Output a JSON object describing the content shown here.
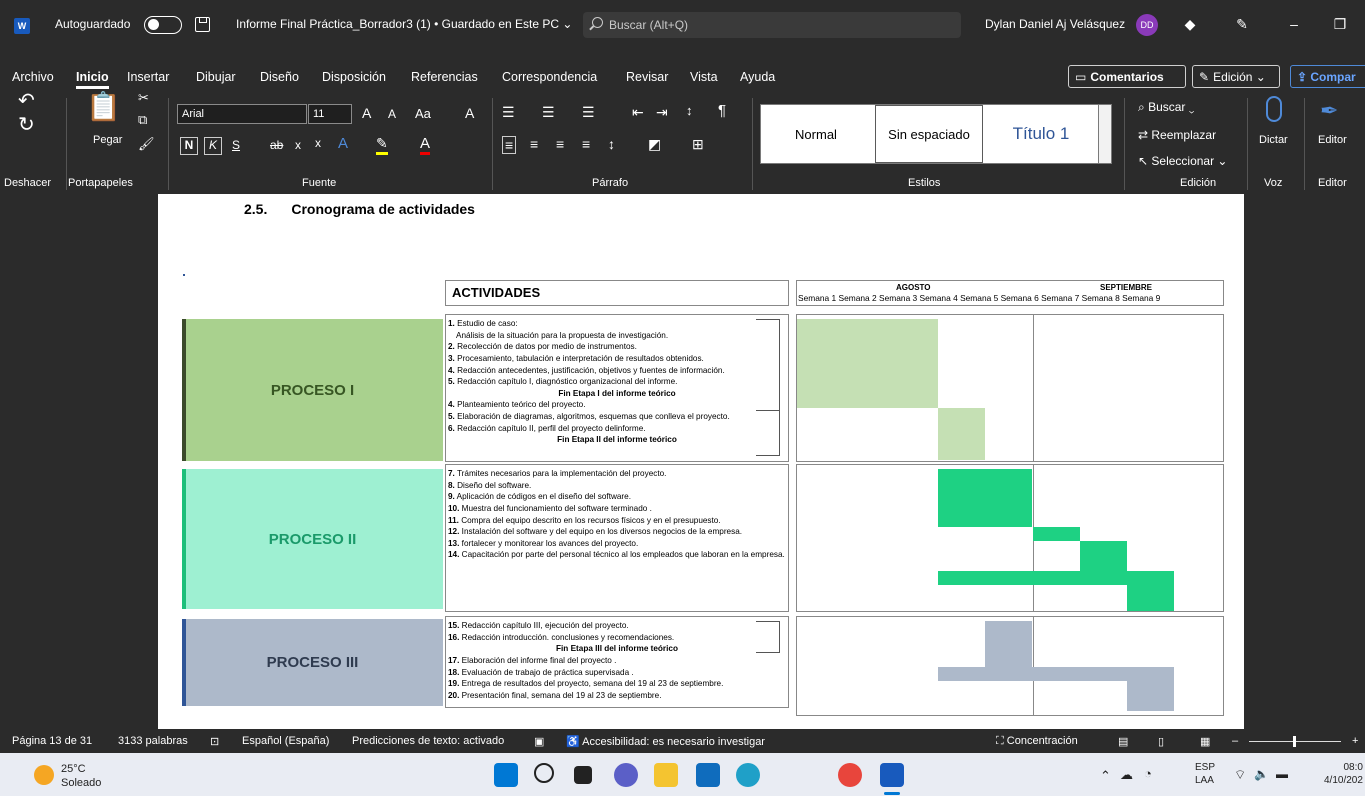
{
  "titlebar": {
    "app_logo": "W",
    "autosave_label": "Autoguardado",
    "doc_title": "Informe Final Práctica_Borrador3 (1) • Guardado en Este PC ⌄",
    "search_placeholder": "Buscar (Alt+Q)",
    "user_name": "Dylan Daniel Aj Velásquez",
    "user_initials": "DD",
    "diamond_icon": "◆",
    "pen_icon": "✎",
    "minimize_icon": "–",
    "restore_icon": "❐"
  },
  "menu": {
    "tabs": [
      "Archivo",
      "Inicio",
      "Insertar",
      "Dibujar",
      "Diseño",
      "Disposición",
      "Referencias",
      "Correspondencia",
      "Revisar",
      "Vista",
      "Ayuda"
    ],
    "comments_label": "Comentarios",
    "editing_label": "Edición ⌄",
    "share_label": "Compar"
  },
  "ribbon": {
    "groups": {
      "undo": "Deshacer",
      "clipboard": "Portapapeles",
      "font": "Fuente",
      "paragraph": "Párrafo",
      "styles": "Estilos",
      "editing": "Edición",
      "voice": "Voz",
      "editor": "Editor"
    },
    "paste_label": "Pegar",
    "font_name": "Arial",
    "font_size": "11",
    "font_grow": "A",
    "font_shrink": "A",
    "change_case": "Aa",
    "clear_format": "A",
    "bold": "N",
    "italic": "K",
    "underline": "S",
    "strike": "ab",
    "subscript": "x",
    "superscript": "x",
    "styles": [
      "Normal",
      "Sin espaciado",
      "Título 1"
    ],
    "find": "Buscar",
    "replace": "Reemplazar",
    "select": "Seleccionar",
    "dictate": "Dictar",
    "editor_btn": "Editor"
  },
  "document": {
    "section_number": "2.5.",
    "section_title": "Cronograma de actividades",
    "activities_header": "ACTIVIDADES",
    "month_august": "AGOSTO",
    "month_september": "SEPTIEMBRE",
    "weeks": [
      "Semana 1",
      "Semana 2",
      "Semana 3",
      "Semana 4",
      "Semana 5",
      "Semana 6",
      "Semana 7",
      "Semana 8",
      "Semana 9"
    ],
    "processes": [
      {
        "name": "PROCESO I",
        "fill": "#a9d18e",
        "bar": "#3a4a2a",
        "lines": [
          "1. Estudio de caso:",
          "   Análisis de la situación para la propuesta de investigación.",
          "2. Recolección de datos por medio de instrumentos.",
          "3. Procesamiento, tabulación e interpretación de resultados obtenidos.",
          "4. Redacción antecedentes, justificación, objetivos y fuentes de información.",
          "5. Redacción capítulo I, diagnóstico organizacional del informe.",
          "Fin Etapa I del informe teórico",
          "4. Planteamiento teórico del proyecto.",
          "5. Elaboración de diagramas, algoritmos, esquemas que conlleva el proyecto.",
          "6. Redacción capítulo II, perfil del proyecto delinforme.",
          "Fin Etapa II del informe teórico"
        ]
      },
      {
        "name": "PROCESO II",
        "fill": "#9ef0d2",
        "bar": "#1dbf7a",
        "lines": [
          "7. Trámites necesarios para la implementación del proyecto.",
          "8. Diseño del software.",
          "9. Aplicación de códigos en el diseño del software.",
          "10. Muestra del funcionamiento del software terminado .",
          "11. Compra del equipo descrito en los recursos físicos y en el presupuesto.",
          "12. Instalación del software y del equipo en los diversos negocios de la empresa.",
          "13. fortalecer y monitorear los avances del proyecto.",
          "14. Capacitación por parte del personal técnico al los empleados que laboran en la empresa."
        ]
      },
      {
        "name": "PROCESO III",
        "fill": "#adb9ca",
        "bar": "#2f5597",
        "lines": [
          "15. Redacción capítulo III, ejecución del proyecto.",
          "16. Redacción introducción. conclusiones y recomendaciones.",
          "Fin Etapa III del informe teórico",
          "17. Elaboración del informe final del proyecto .",
          "18. Evaluación de trabajo de práctica supervisada .",
          "19. Entrega de resultados del proyecto, semana del 19 al 23 de septiembre.",
          "20. Presentación final, semana del 19 al 23 de septiembre."
        ]
      }
    ],
    "colors": {
      "proc1_gantt": "#c5e0b4",
      "proc2_gantt": "#1ed183",
      "proc3_gantt": "#adb9ca"
    }
  },
  "status": {
    "page": "Página 13 de 31",
    "words": "3133 palabras",
    "language": "Español (España)",
    "predictions": "Predicciones de texto: activado",
    "accessibility": "Accesibilidad: es necesario investigar",
    "focus": "Concentración",
    "zoom_minus": "–",
    "zoom_plus": "+"
  },
  "taskbar": {
    "temperature": "25°C",
    "weather": "Soleado",
    "lang1": "ESP",
    "lang2": "LAA",
    "time": "08:0",
    "date": "4/10/202"
  }
}
